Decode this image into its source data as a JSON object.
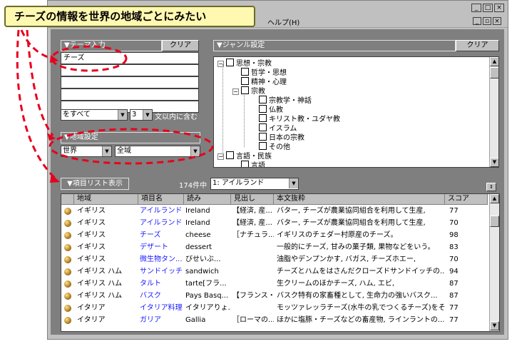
{
  "callout_text": "チーズの情報を世界の地域ごとにみたい",
  "menu_partial": "ヘルプ(H)",
  "theme": {
    "header": "▼テーマ入力",
    "clear": "クリア",
    "keyword": "チーズ",
    "mode": "をすべて",
    "count": "3",
    "suffix": "文以内に含む"
  },
  "genre": {
    "header": "▼ジャンル設定",
    "clear": "クリア",
    "nodes": [
      "思想・宗教",
      "哲学・思想",
      "精神・心理",
      "宗教",
      "宗教学・神話",
      "仏教",
      "キリスト教・ユダヤ教",
      "イスラム",
      "日本の宗教",
      "その他",
      "言語・民族",
      "言語"
    ]
  },
  "region": {
    "header": "▼地域設定",
    "world": "世界",
    "area": "全域"
  },
  "list_button": "▼項目リスト表示",
  "count_text": "174件中",
  "current_item": "1:  アイルランド",
  "columns": [
    "地域",
    "項目名",
    "読み",
    "見出し",
    "本文抜粋",
    "スコア"
  ],
  "rows": [
    [
      "イギリス",
      "アイルランド",
      "Ireland",
      "【経済, 産...",
      "バター, チーズが農業協同組合を利用して生産,",
      "77"
    ],
    [
      "イギリス",
      "アイルランド",
      "Ireland",
      "【経済, 産...",
      "バター, チーズが農業協同組合を利用して生産,",
      "70"
    ],
    [
      "イギリス",
      "チーズ",
      "cheese",
      "［ナチュラ...",
      "イギリスのチェダー村原産のチーズ。",
      "98"
    ],
    [
      "イギリス",
      "デザート",
      "dessert",
      "",
      "一般的にチーズ, 甘みの菓子類, 果物などをいう。",
      "83"
    ],
    [
      "イギリス",
      "微生物タン...",
      "びせいぶ...",
      "",
      "油脂やデンプンかす, バガス, チーズホエー,",
      "70"
    ],
    [
      "イギリス ハム",
      "サンドイッチ",
      "sandwich",
      "",
      "チーズとハムをはさんだクローズドサンドイッチの...",
      "94"
    ],
    [
      "イギリス ハム",
      "タルト",
      "tarte[フラ...",
      "",
      "生クリームのほかチーズ, ハム, エビ,",
      "87"
    ],
    [
      "イギリス ハム",
      "バスク",
      "Pays Basq...",
      "【フランス・...",
      "バスク特有の家畜種として, 生命力の強いバスク...",
      "87"
    ],
    [
      "イタリア",
      "イタリア料理",
      "イタリアりょ...",
      "",
      "モッツァレッラチーズ(水牛の乳でつくるチーズ)をそ...",
      "77"
    ],
    [
      "イタリア",
      "ガリア",
      "Gallia",
      "［ローマの...",
      "ほかに塩豚・チーズなどの畜産物, ラインラントの...",
      "77"
    ]
  ]
}
